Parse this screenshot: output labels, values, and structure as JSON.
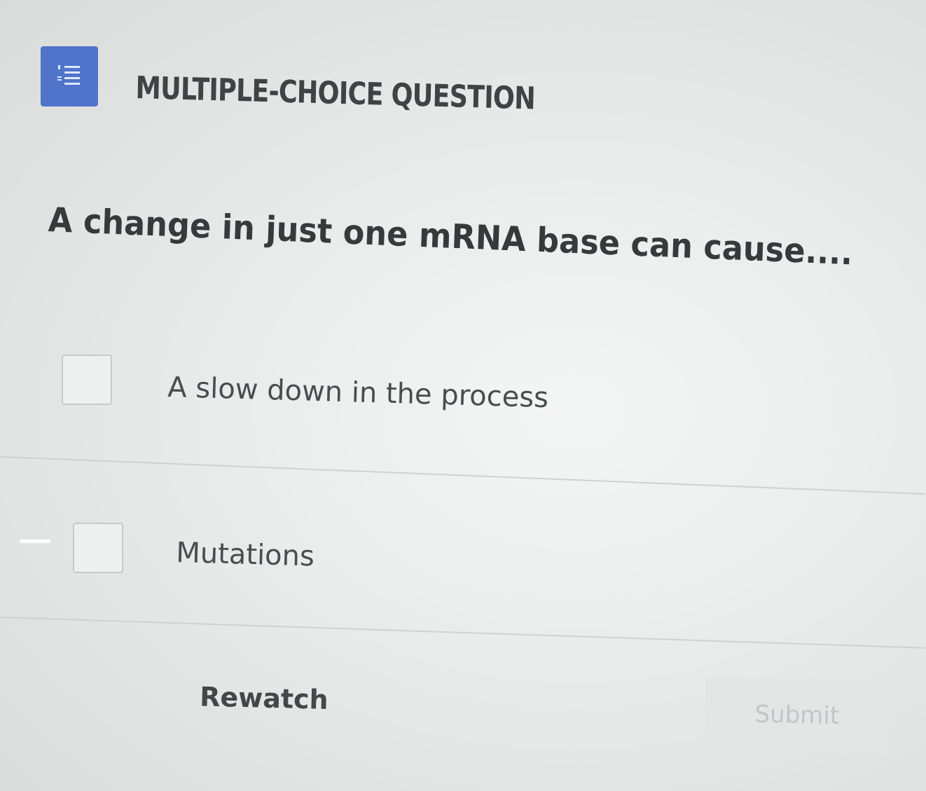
{
  "header": {
    "icon": "numbered-list-icon",
    "title": "MULTIPLE-CHOICE QUESTION"
  },
  "question": {
    "text": "A change in just one mRNA base can cause...."
  },
  "options": [
    {
      "label": "A slow down in the process",
      "checked": false
    },
    {
      "label": "Mutations",
      "checked": false
    }
  ],
  "actions": {
    "rewatch_label": "Rewatch",
    "submit_label": "Submit",
    "submit_enabled": false
  },
  "colors": {
    "icon_background": "#4f74c9",
    "background": "#e6e8e8",
    "text": "#3a3b3d",
    "submit_disabled_text": "#c3c5c7"
  }
}
